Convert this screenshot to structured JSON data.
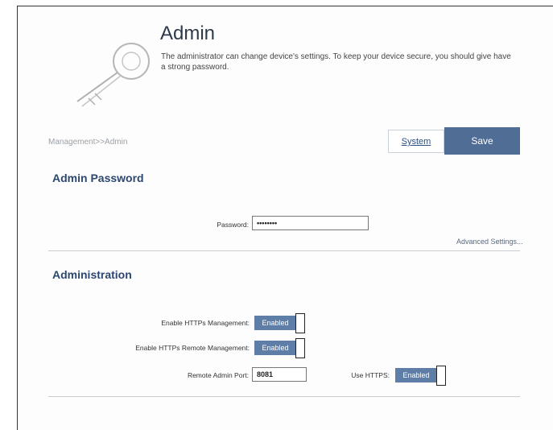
{
  "header": {
    "title": "Admin",
    "description": "The administrator can change device's settings. To keep your device secure, you should give have a strong password."
  },
  "breadcrumb": "Management>>Admin",
  "toolbar": {
    "system_label": "System",
    "save_label": "Save"
  },
  "admin_password": {
    "title": "Admin Password",
    "password_label": "Password:",
    "password_value": "••••••••",
    "advanced_link": "Advanced Settings..."
  },
  "administration": {
    "title": "Administration",
    "https_mgmt_label": "Enable HTTPs Management:",
    "https_mgmt_value": "Enabled",
    "https_remote_label": "Enable HTTPs Remote Management:",
    "https_remote_value": "Enabled",
    "remote_port_label": "Remote Admin Port:",
    "remote_port_value": "8081",
    "use_https_label": "Use HTTPS:",
    "use_https_value": "Enabled"
  },
  "colors": {
    "accent": "#4f6d95",
    "toggle": "#5e7ea8",
    "section_title": "#2c4770"
  },
  "icons": {
    "illustration": "key-icon"
  }
}
